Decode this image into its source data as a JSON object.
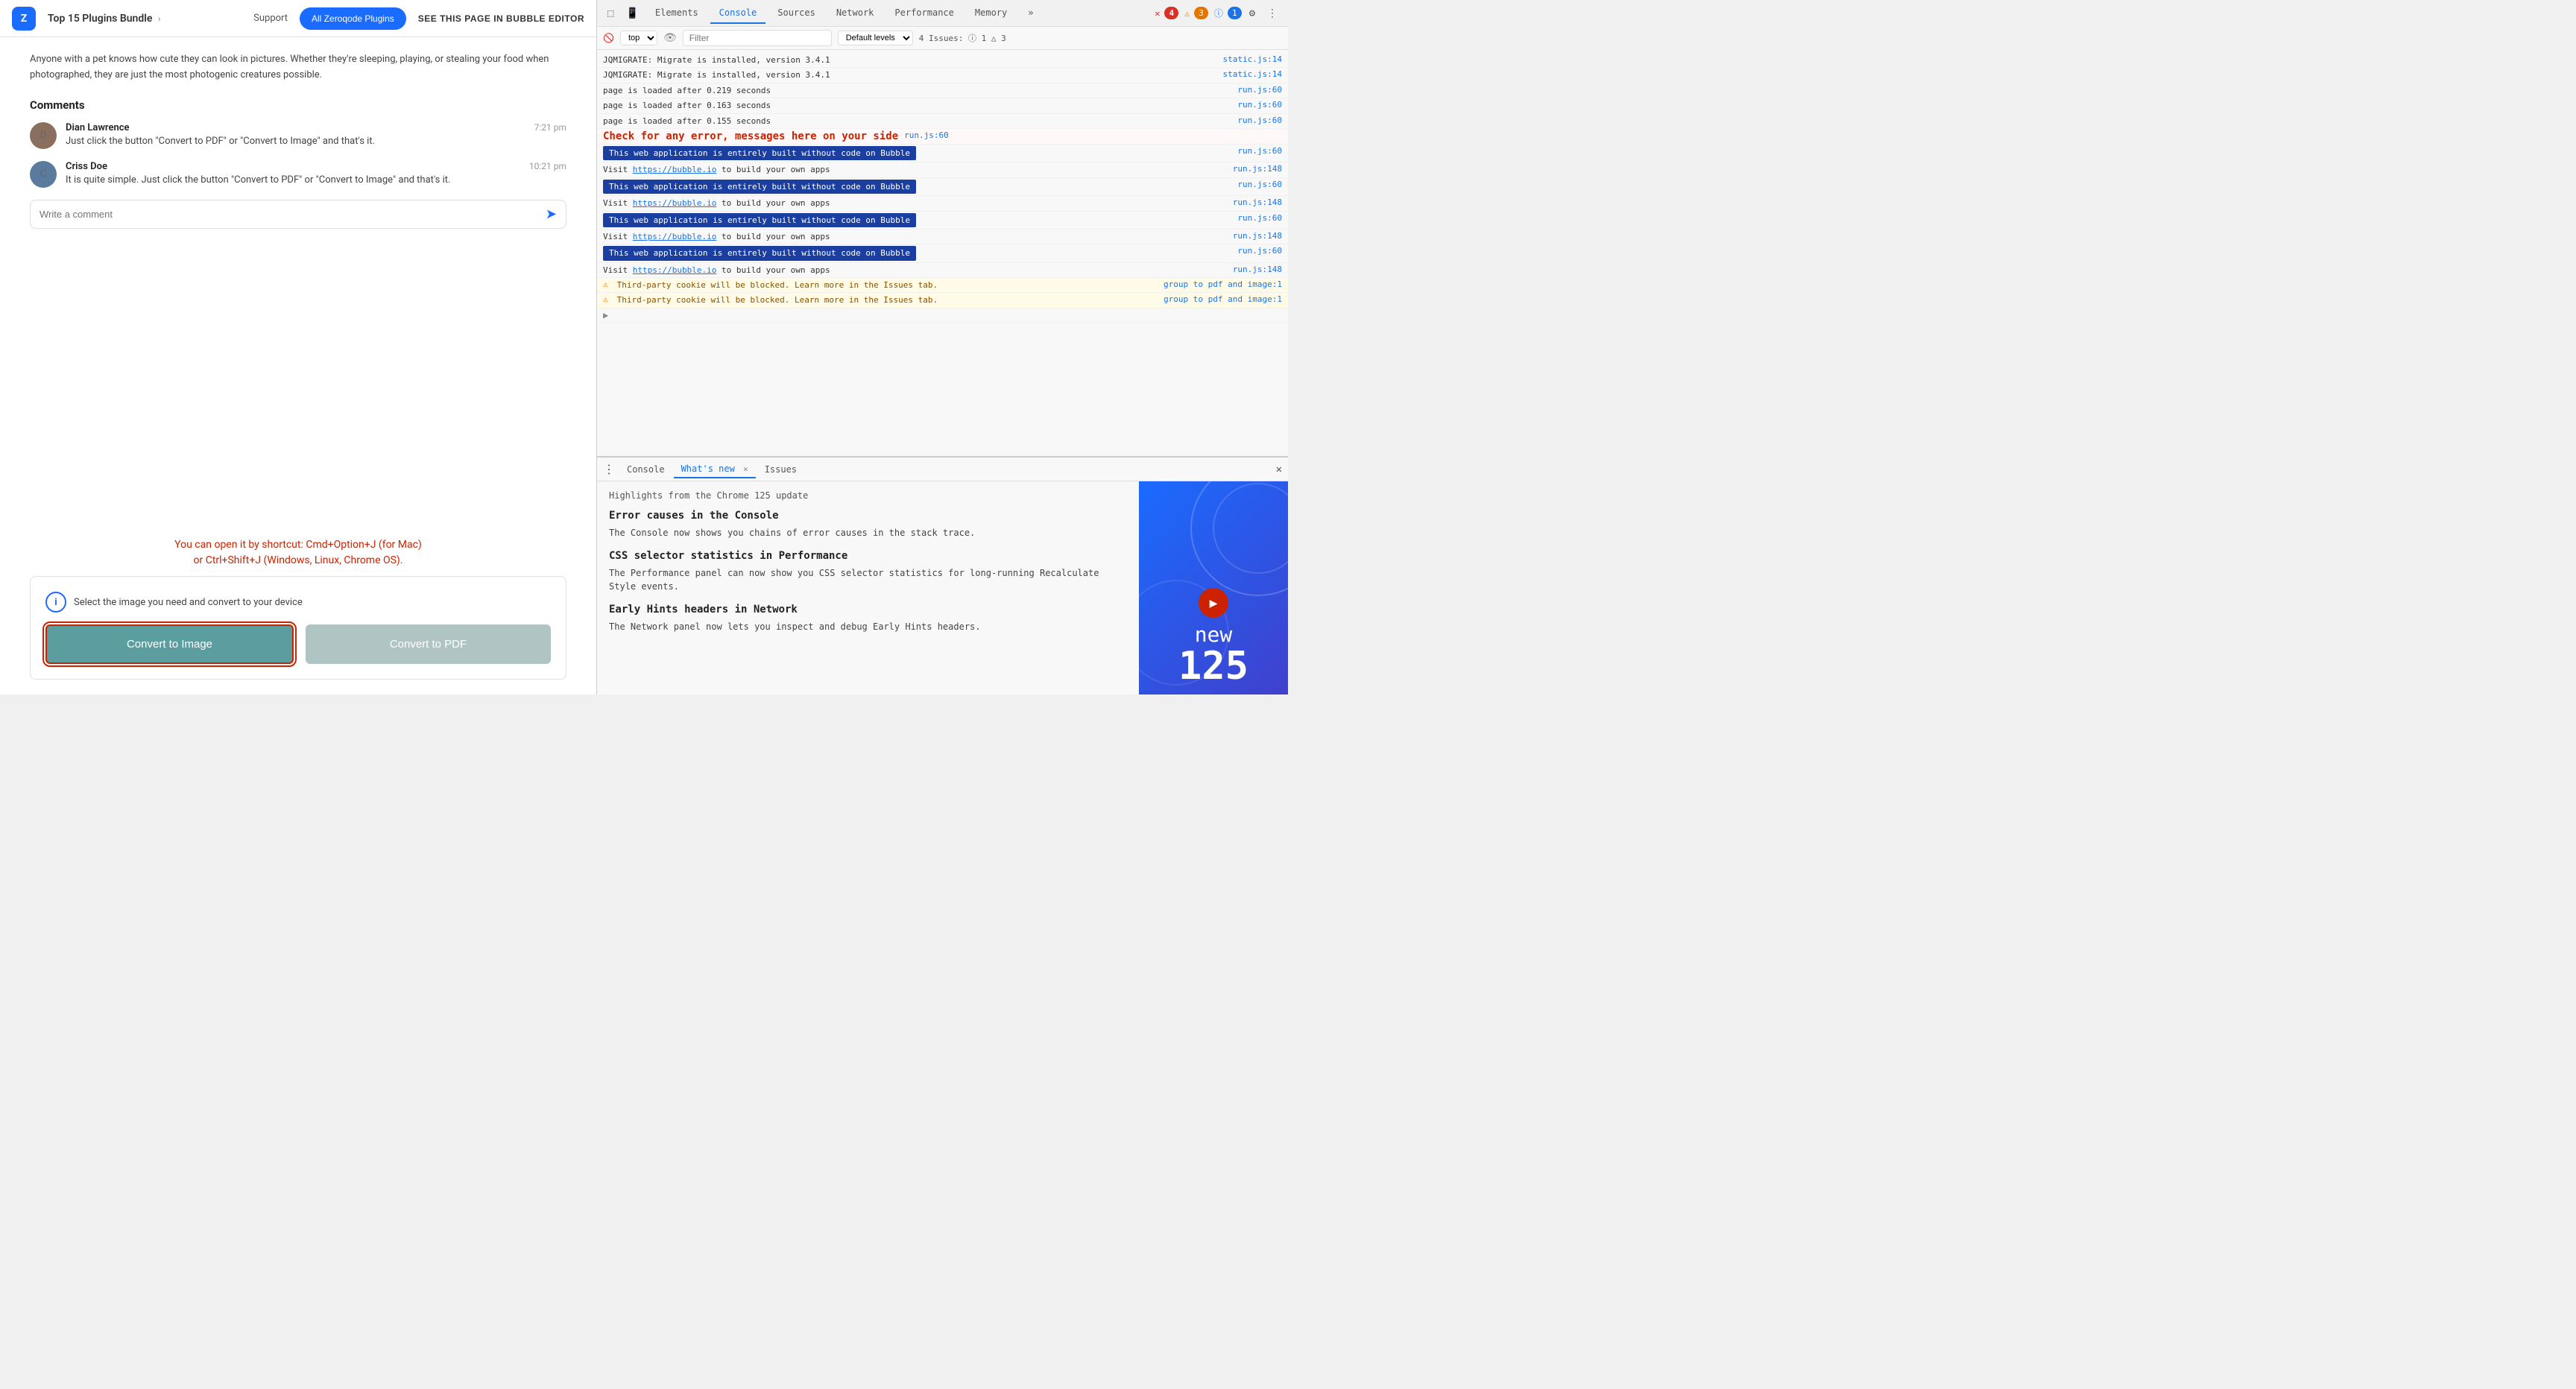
{
  "app": {
    "logo_text": "Z",
    "title": "Top 15 Plugins Bundle",
    "nav": {
      "support_label": "Support",
      "plugins_btn_label": "All Zeroqode Plugins",
      "editor_btn_label": "SEE THIS PAGE IN BUBBLE EDITOR"
    },
    "description": "Anyone with a pet knows how cute they can look in pictures. Whether they're sleeping, playing, or stealing your food when photographed, they are just the most photogenic creatures possible.",
    "comments_heading": "Comments",
    "comments": [
      {
        "name": "Dian Lawrence",
        "time": "7:21 pm",
        "text": "Just click the button \"Convert to PDF\" or \"Convert to Image\" and that's it.",
        "avatar_initials": "D"
      },
      {
        "name": "Criss Doe",
        "time": "10:21 pm",
        "text": "It is quite simple. Just click the button \"Convert to PDF\" or \"Convert to Image\" and that's it.",
        "avatar_initials": "C"
      }
    ],
    "comment_placeholder": "Write a comment",
    "annotation": {
      "line1": "You can open it by shortcut: Cmd+Option+J (for Mac)",
      "line2": "or Ctrl+Shift+J (Windows, Linux, Chrome OS)."
    },
    "convert_info_text": "Select the image you need and convert to your device",
    "btn_convert_image": "Convert to Image",
    "btn_convert_pdf": "Convert to PDF"
  },
  "devtools": {
    "header_tabs": [
      "Elements",
      "Console",
      "Sources",
      "Network",
      "Performance",
      "Memory",
      "»"
    ],
    "active_tab": "Console",
    "icons": {
      "inspect": "⬛",
      "device": "📱",
      "settings": "⚙",
      "more": "⋮",
      "close": "✕"
    },
    "error_count": "4",
    "warn_count": "3",
    "info_count": "1",
    "issues_text": "4 Issues: ⓘ 1  △ 3",
    "console": {
      "top_label": "top",
      "filter_placeholder": "Filter",
      "level_label": "Default levels",
      "messages": [
        {
          "text": "JQMIGRATE: Migrate is installed, version 3.4.1",
          "source": "static.js:14",
          "type": "normal"
        },
        {
          "text": "JQMIGRATE: Migrate is installed, version 3.4.1",
          "source": "static.js:14",
          "type": "normal"
        },
        {
          "text": "page is loaded after 0.219 seconds",
          "source": "run.js:60",
          "type": "normal"
        },
        {
          "text": "page is loaded after 0.163 seconds",
          "source": "run.js:60",
          "type": "normal"
        },
        {
          "text": "page is loaded after 0.155 seconds",
          "source": "run.js:60",
          "type": "normal"
        },
        {
          "text": "Check for any error, messages here on your side",
          "source": "run.js:60",
          "type": "check-error"
        },
        {
          "text": "BUBBLE_BADGE",
          "source": "run.js:60",
          "type": "bubble",
          "badge": "This web application is entirely built without code on Bubble"
        },
        {
          "text": "Visit https://bubble.io to build your own apps",
          "source": "run.js:148",
          "type": "link",
          "link_text": "https://bubble.io"
        },
        {
          "text": "BUBBLE_BADGE",
          "source": "run.js:60",
          "type": "bubble",
          "badge": "This web application is entirely built without code on Bubble"
        },
        {
          "text": "Visit https://bubble.io to build your own apps",
          "source": "run.js:148",
          "type": "link",
          "link_text": "https://bubble.io"
        },
        {
          "text": "BUBBLE_BADGE",
          "source": "run.js:60",
          "type": "bubble",
          "badge": "This web application is entirely built without code on Bubble"
        },
        {
          "text": "Visit https://bubble.io to build your own apps",
          "source": "run.js:148",
          "type": "link",
          "link_text": "https://bubble.io"
        },
        {
          "text": "BUBBLE_BADGE",
          "source": "run.js:60",
          "type": "bubble",
          "badge": "This web application is entirely built without code on Bubble"
        },
        {
          "text": "Visit https://bubble.io to build your own apps",
          "source": "run.js:148",
          "type": "link",
          "link_text": "https://bubble.io"
        },
        {
          "text": "⚠ Third-party cookie will be blocked. Learn more in the Issues tab.",
          "source": "group to pdf and image:1",
          "type": "warn"
        },
        {
          "text": "⚠ Third-party cookie will be blocked. Learn more in the Issues tab.",
          "source": "group to pdf and image:1",
          "type": "warn"
        },
        {
          "text": "▶",
          "source": "",
          "type": "arrow"
        }
      ]
    },
    "bottom": {
      "menu_icon": "⋮",
      "close_icon": "✕",
      "tabs": [
        "Console",
        "What's new",
        "Issues"
      ],
      "active_tab": "What's new",
      "highlights_text": "Highlights from the Chrome 125 update",
      "sections": [
        {
          "title": "Error causes in the Console",
          "text": "The Console now shows you chains of error causes in the stack trace."
        },
        {
          "title": "CSS selector statistics in Performance",
          "text": "The Performance panel can now show you CSS selector statistics for long-running Recalculate Style events."
        },
        {
          "title": "Early Hints headers in Network",
          "text": "The Network panel now lets you inspect and debug Early Hints headers."
        }
      ],
      "thumbnail": {
        "new_label": "new",
        "version_label": "125"
      }
    }
  }
}
